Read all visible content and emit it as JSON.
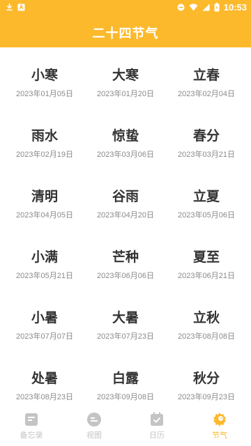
{
  "status_bar": {
    "time": "10:53"
  },
  "header": {
    "title": "二十四节气"
  },
  "terms": [
    {
      "name": "小寒",
      "date": "2023年01月05日"
    },
    {
      "name": "大寒",
      "date": "2023年01月20日"
    },
    {
      "name": "立春",
      "date": "2023年02月04日"
    },
    {
      "name": "雨水",
      "date": "2023年02月19日"
    },
    {
      "name": "惊蛰",
      "date": "2023年03月06日"
    },
    {
      "name": "春分",
      "date": "2023年03月21日"
    },
    {
      "name": "清明",
      "date": "2023年04月05日"
    },
    {
      "name": "谷雨",
      "date": "2023年04月20日"
    },
    {
      "name": "立夏",
      "date": "2023年05月06日"
    },
    {
      "name": "小满",
      "date": "2023年05月21日"
    },
    {
      "name": "芒种",
      "date": "2023年06月06日"
    },
    {
      "name": "夏至",
      "date": "2023年06月21日"
    },
    {
      "name": "小暑",
      "date": "2023年07月07日"
    },
    {
      "name": "大暑",
      "date": "2023年07月23日"
    },
    {
      "name": "立秋",
      "date": "2023年08月08日"
    },
    {
      "name": "处暑",
      "date": "2023年08月23日"
    },
    {
      "name": "白露",
      "date": "2023年09月08日"
    },
    {
      "name": "秋分",
      "date": "2023年09月23日"
    }
  ],
  "tabs": [
    {
      "label": "备忘录",
      "icon": "memo-icon",
      "active": false
    },
    {
      "label": "视图",
      "icon": "view-icon",
      "active": false
    },
    {
      "label": "日历",
      "icon": "calendar-icon",
      "active": false
    },
    {
      "label": "节气",
      "icon": "solar-term-icon",
      "active": true
    }
  ],
  "colors": {
    "accent": "#FDB92C",
    "text": "#333333",
    "muted": "#8a8a8a",
    "inactive": "#c4c4c4"
  }
}
